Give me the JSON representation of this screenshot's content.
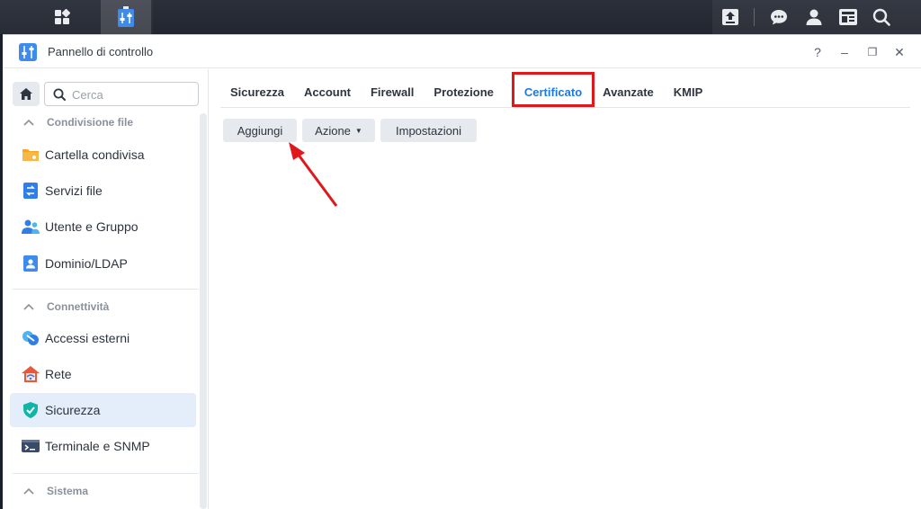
{
  "window": {
    "title": "Pannello di controllo"
  },
  "controls": {
    "help": "?",
    "minimize": "–",
    "restore": "❐",
    "close": "✕"
  },
  "search": {
    "placeholder": "Cerca"
  },
  "sidebar": {
    "sections": [
      {
        "label": "Condivisione file"
      },
      {
        "label": "Connettività"
      },
      {
        "label": "Sistema"
      }
    ],
    "items": [
      {
        "label": "Cartella condivisa",
        "icon": "folder-icon"
      },
      {
        "label": "Servizi file",
        "icon": "file-services-icon"
      },
      {
        "label": "Utente e Gruppo",
        "icon": "users-icon"
      },
      {
        "label": "Dominio/LDAP",
        "icon": "domain-icon"
      },
      {
        "label": "Accessi esterni",
        "icon": "external-access-icon"
      },
      {
        "label": "Rete",
        "icon": "network-icon"
      },
      {
        "label": "Sicurezza",
        "icon": "shield-icon",
        "selected": true
      },
      {
        "label": "Terminale e SNMP",
        "icon": "terminal-icon"
      }
    ]
  },
  "tabs": [
    {
      "label": "Sicurezza"
    },
    {
      "label": "Account"
    },
    {
      "label": "Firewall"
    },
    {
      "label": "Protezione"
    },
    {
      "label": "Certificato",
      "active": true
    },
    {
      "label": "Avanzate"
    },
    {
      "label": "KMIP"
    }
  ],
  "toolbar": {
    "add_label": "Aggiungi",
    "action_label": "Azione",
    "settings_label": "Impostazioni"
  },
  "colors": {
    "accent": "#1f7ae0",
    "highlight": "#e0181b",
    "selected_bg": "#e4eefa"
  }
}
